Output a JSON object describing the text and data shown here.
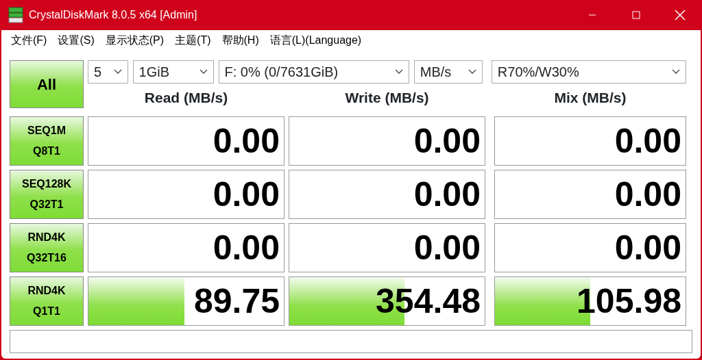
{
  "window": {
    "title": "CrystalDiskMark 8.0.5 x64 [Admin]"
  },
  "menu": [
    "文件(F)",
    "设置(S)",
    "显示状态(P)",
    "主题(T)",
    "帮助(H)",
    "语言(L)(Language)"
  ],
  "all_button": "All",
  "dropdowns": [
    {
      "value": "5"
    },
    {
      "value": "1GiB"
    },
    {
      "value": "F: 0% (0/7631GiB)"
    },
    {
      "value": "MB/s"
    },
    {
      "value": "R70%/W30%"
    }
  ],
  "columns": [
    "Read (MB/s)",
    "Write (MB/s)",
    "Mix (MB/s)"
  ],
  "rows": [
    {
      "test": [
        "SEQ1M",
        "Q8T1"
      ],
      "results": [
        {
          "value": "0.00"
        },
        {
          "value": "0.00"
        },
        {
          "value": "0.00"
        }
      ]
    },
    {
      "test": [
        "SEQ128K",
        "Q32T1"
      ],
      "results": [
        {
          "value": "0.00"
        },
        {
          "value": "0.00"
        },
        {
          "value": "0.00"
        }
      ]
    },
    {
      "test": [
        "RND4K",
        "Q32T16"
      ],
      "results": [
        {
          "value": "0.00"
        },
        {
          "value": "0.00"
        },
        {
          "value": "0.00"
        }
      ]
    },
    {
      "test": [
        "RND4K",
        "Q1T1"
      ],
      "results": [
        {
          "value": "89.75",
          "level": 0.49
        },
        {
          "value": "354.48",
          "level": 0.59
        },
        {
          "value": "105.98",
          "level": 0.5
        }
      ]
    }
  ]
}
